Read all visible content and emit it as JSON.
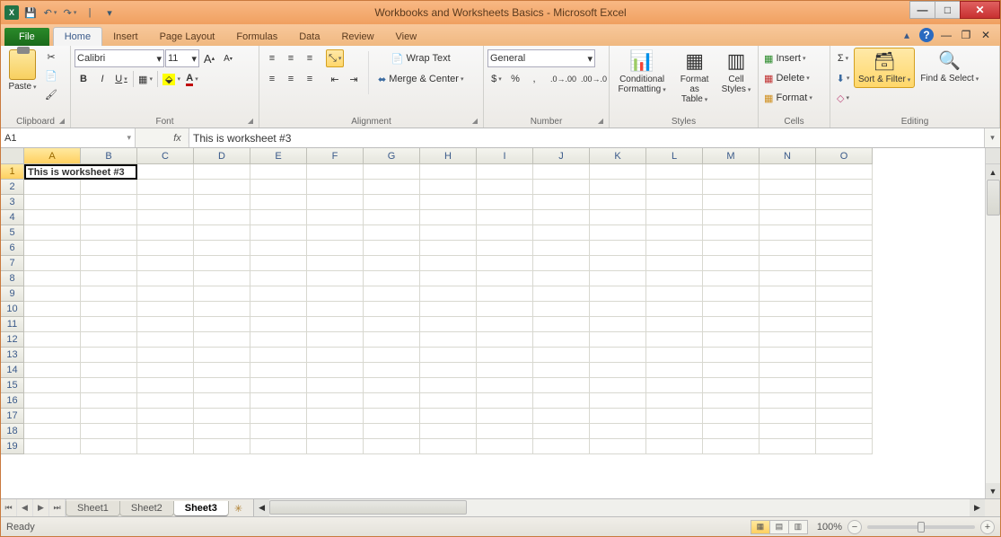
{
  "titlebar": {
    "title": "Workbooks and Worksheets Basics - Microsoft Excel"
  },
  "qat": {
    "app": "X"
  },
  "tabs": {
    "file": "File",
    "home": "Home",
    "insert": "Insert",
    "page_layout": "Page Layout",
    "formulas": "Formulas",
    "data": "Data",
    "review": "Review",
    "view": "View"
  },
  "ribbon": {
    "clipboard": {
      "label": "Clipboard",
      "paste": "Paste"
    },
    "font": {
      "label": "Font",
      "name": "Calibri",
      "size": "11",
      "bold": "B",
      "italic": "I",
      "underline": "U"
    },
    "alignment": {
      "label": "Alignment",
      "wrap": "Wrap Text",
      "merge": "Merge & Center"
    },
    "number": {
      "label": "Number",
      "format": "General",
      "currency": "$",
      "percent": "%",
      "comma": ","
    },
    "styles": {
      "label": "Styles",
      "cond": "Conditional Formatting",
      "table": "Format as Table",
      "cell": "Cell Styles"
    },
    "cells": {
      "label": "Cells",
      "insert": "Insert",
      "delete": "Delete",
      "format": "Format"
    },
    "editing": {
      "label": "Editing",
      "sort": "Sort & Filter",
      "find": "Find & Select"
    }
  },
  "formula_bar": {
    "name_box": "A1",
    "fx": "fx",
    "value": "This is worksheet #3"
  },
  "grid": {
    "columns": [
      "A",
      "B",
      "C",
      "D",
      "E",
      "F",
      "G",
      "H",
      "I",
      "J",
      "K",
      "L",
      "M",
      "N",
      "O"
    ],
    "rows": [
      "1",
      "2",
      "3",
      "4",
      "5",
      "6",
      "7",
      "8",
      "9",
      "10",
      "11",
      "12",
      "13",
      "14",
      "15",
      "16",
      "17",
      "18",
      "19"
    ],
    "a1": "This is worksheet #3"
  },
  "sheets": {
    "s1": "Sheet1",
    "s2": "Sheet2",
    "s3": "Sheet3"
  },
  "status": {
    "ready": "Ready",
    "zoom": "100%"
  }
}
